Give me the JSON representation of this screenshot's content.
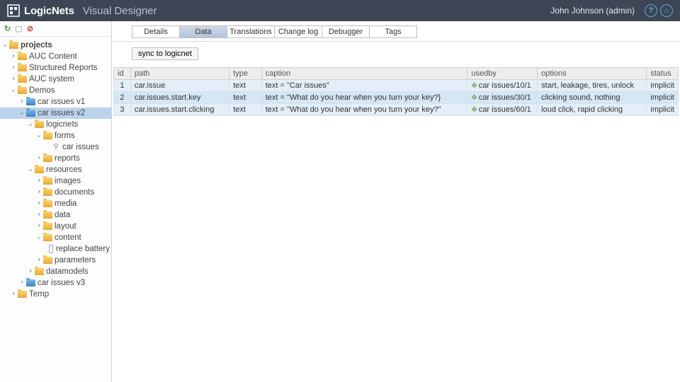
{
  "header": {
    "brand": "LogicNets",
    "subtitle": "Visual Designer",
    "user": "John Johnson (admin)"
  },
  "tabs": {
    "details": "Details",
    "data": "Data",
    "translations": "Translations",
    "changelog": "Change log",
    "debugger": "Debugger",
    "tags": "Tags",
    "active": "data"
  },
  "sync_label": "sync to logicnet",
  "tree": {
    "root": "projects",
    "items": [
      {
        "label": "AUC Content",
        "depth": 1,
        "arrow": "closed",
        "icon": "folder"
      },
      {
        "label": "Structured Reports",
        "depth": 1,
        "arrow": "closed",
        "icon": "folder"
      },
      {
        "label": "AUC system",
        "depth": 1,
        "arrow": "closed",
        "icon": "folder"
      },
      {
        "label": "Demos",
        "depth": 1,
        "arrow": "open",
        "icon": "folder"
      },
      {
        "label": "car issues v1",
        "depth": 2,
        "arrow": "closed",
        "icon": "folder-blue"
      },
      {
        "label": "car issues v2",
        "depth": 2,
        "arrow": "open",
        "icon": "folder-blue",
        "selected": true
      },
      {
        "label": "logicnets",
        "depth": 3,
        "arrow": "open",
        "icon": "folder"
      },
      {
        "label": "forms",
        "depth": 4,
        "arrow": "open",
        "icon": "folder"
      },
      {
        "label": "car issues",
        "depth": 5,
        "arrow": "none",
        "icon": "item"
      },
      {
        "label": "reports",
        "depth": 4,
        "arrow": "closed",
        "icon": "folder"
      },
      {
        "label": "resources",
        "depth": 3,
        "arrow": "open",
        "icon": "folder"
      },
      {
        "label": "images",
        "depth": 4,
        "arrow": "closed",
        "icon": "folder"
      },
      {
        "label": "documents",
        "depth": 4,
        "arrow": "closed",
        "icon": "folder"
      },
      {
        "label": "media",
        "depth": 4,
        "arrow": "closed",
        "icon": "folder"
      },
      {
        "label": "data",
        "depth": 4,
        "arrow": "closed",
        "icon": "folder"
      },
      {
        "label": "layout",
        "depth": 4,
        "arrow": "closed",
        "icon": "folder"
      },
      {
        "label": "content",
        "depth": 4,
        "arrow": "open",
        "icon": "folder"
      },
      {
        "label": "replace battery",
        "depth": 5,
        "arrow": "none",
        "icon": "file"
      },
      {
        "label": "parameters",
        "depth": 4,
        "arrow": "closed",
        "icon": "folder"
      },
      {
        "label": "datamodels",
        "depth": 3,
        "arrow": "closed",
        "icon": "folder"
      },
      {
        "label": "car issues v3",
        "depth": 2,
        "arrow": "closed",
        "icon": "folder-blue"
      },
      {
        "label": "Temp",
        "depth": 1,
        "arrow": "closed",
        "icon": "folder"
      }
    ]
  },
  "table": {
    "headers": {
      "id": "id",
      "path": "path",
      "type": "type",
      "caption": "caption",
      "usedby": "usedby",
      "options": "options",
      "status": "status"
    },
    "rows": [
      {
        "id": "1",
        "path": "car.issue",
        "type": "text",
        "caption": "text = \"Car issues\"",
        "usedby": "car issues/10/1",
        "options": "start, leakage, tires, unlock",
        "status": "implicit"
      },
      {
        "id": "2",
        "path": "car.issues.start.key",
        "type": "text",
        "caption": "text = \"What do you hear when you turn your key?}",
        "usedby": "car issues/30/1",
        "options": "clicking sound, nothing",
        "status": "implicit"
      },
      {
        "id": "3",
        "path": "car.issues.start.clicking",
        "type": "text",
        "caption": "text = \"What do you hear when you turn your key?\"",
        "usedby": "car issues/60/1",
        "options": "loud click, rapid clicking",
        "status": "implicit"
      }
    ]
  }
}
